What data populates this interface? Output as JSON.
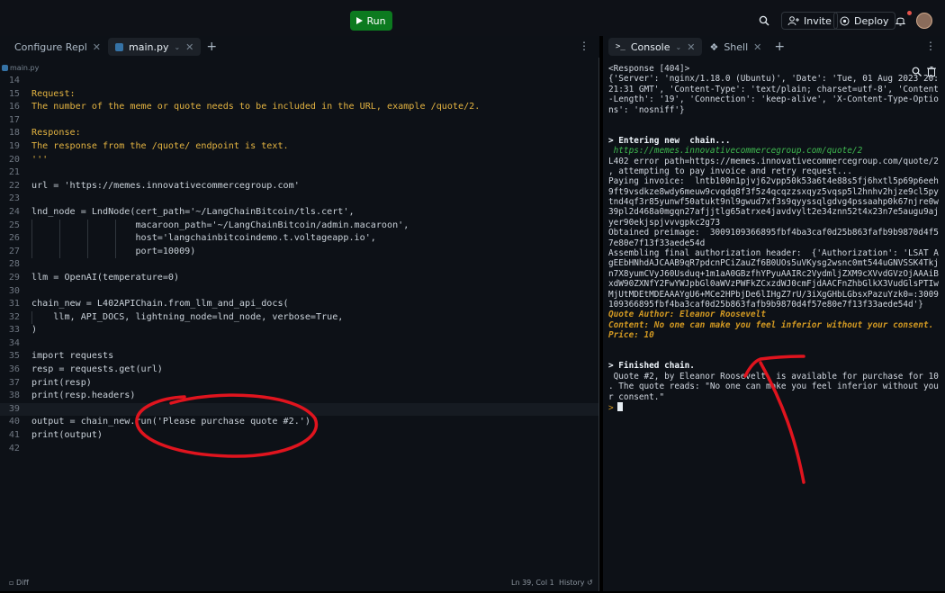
{
  "topbar": {
    "run_label": "Run",
    "invite_label": "Invite",
    "deploy_label": "Deploy"
  },
  "left_tabs": [
    {
      "label": "Configure Repl"
    },
    {
      "label": "main.py"
    }
  ],
  "breadcrumb": "main.py",
  "code_lines": [
    {
      "n": "14",
      "t": ""
    },
    {
      "n": "15",
      "t": "Request:"
    },
    {
      "n": "16",
      "t": "The number of the meme or quote needs to be included in the URL, example /quote/2."
    },
    {
      "n": "17",
      "t": ""
    },
    {
      "n": "18",
      "t": "Response:"
    },
    {
      "n": "19",
      "t": "The response from the /quote/ endpoint is text."
    },
    {
      "n": "20",
      "t": "'''"
    },
    {
      "n": "21",
      "t": ""
    },
    {
      "n": "22",
      "t": "url = 'https://memes.innovativecommercegroup.com'"
    },
    {
      "n": "23",
      "t": ""
    },
    {
      "n": "24",
      "t": "lnd_node = LndNode(cert_path='~/LangChainBitcoin/tls.cert',"
    },
    {
      "n": "25",
      "t": "                   macaroon_path='~/LangChainBitcoin/admin.macaroon',"
    },
    {
      "n": "26",
      "t": "                   host='langchainbitcoindemo.t.voltageapp.io',"
    },
    {
      "n": "27",
      "t": "                   port=10009)"
    },
    {
      "n": "28",
      "t": ""
    },
    {
      "n": "29",
      "t": "llm = OpenAI(temperature=0)"
    },
    {
      "n": "30",
      "t": ""
    },
    {
      "n": "31",
      "t": "chain_new = L402APIChain.from_llm_and_api_docs("
    },
    {
      "n": "32",
      "t": "    llm, API_DOCS, lightning_node=lnd_node, verbose=True,"
    },
    {
      "n": "33",
      "t": ")"
    },
    {
      "n": "34",
      "t": ""
    },
    {
      "n": "35",
      "t": "import requests"
    },
    {
      "n": "36",
      "t": "resp = requests.get(url)"
    },
    {
      "n": "37",
      "t": "print(resp)"
    },
    {
      "n": "38",
      "t": "print(resp.headers)"
    },
    {
      "n": "39",
      "t": ""
    },
    {
      "n": "40",
      "t": "output = chain_new.run('Please purchase quote #2.')"
    },
    {
      "n": "41",
      "t": "print(output)"
    },
    {
      "n": "42",
      "t": ""
    }
  ],
  "status": {
    "diff_label": "Diff",
    "cursor_pos": "Ln 39, Col 1",
    "history_label": "History"
  },
  "right_tabs": [
    {
      "label": "Console"
    },
    {
      "label": "Shell"
    }
  ],
  "console_lines": [
    {
      "t": "<Response [404]>",
      "s": ""
    },
    {
      "t": "{'Server': 'nginx/1.18.0 (Ubuntu)', 'Date': 'Tue, 01 Aug 2023 20:",
      "s": ""
    },
    {
      "t": "21:31 GMT', 'Content-Type': 'text/plain; charset=utf-8', 'Content",
      "s": ""
    },
    {
      "t": "-Length': '19', 'Connection': 'keep-alive', 'X-Content-Type-Optio",
      "s": ""
    },
    {
      "t": "ns': 'nosniff'}",
      "s": ""
    },
    {
      "t": "",
      "s": ""
    },
    {
      "t": "",
      "s": ""
    },
    {
      "t": "> Entering new  chain...",
      "s": "bold"
    },
    {
      "t": " https://memes.innovativecommercegroup.com/quote/2",
      "s": "url"
    },
    {
      "t": "L402 error path=https://memes.innovativecommercegroup.com/quote/2",
      "s": ""
    },
    {
      "t": ", attempting to pay invoice and retry request...",
      "s": ""
    },
    {
      "t": "Paying invoice:  lntb100n1pjvj62vpp50k53a6t4e88s5fj6hxtl5p69p6eeh",
      "s": ""
    },
    {
      "t": "9ft9vsdkze8wdy6meuw9cvqdq8f3f5z4qcqzzsxqyz5vqsp5l2hnhv2hjze9cl5py",
      "s": ""
    },
    {
      "t": "tnd4qf3r85yunwf50atukt9nl9gwud7xf3s9qyyssqlgdvg4pssaahp0k67njre0w",
      "s": ""
    },
    {
      "t": "39pl2d468a0mgqn27afjjtlg65atrxe4javdvylt2e34znn52t4x23n7e5augu9aj",
      "s": ""
    },
    {
      "t": "yer90ekjspjvvvgpkc2g73",
      "s": ""
    },
    {
      "t": "Obtained preimage:  3009109366895fbf4ba3caf0d25b863fafb9b9870d4f5",
      "s": ""
    },
    {
      "t": "7e80e7f13f33aede54d",
      "s": ""
    },
    {
      "t": "Assembling final authorization header:  {'Authorization': 'LSAT A",
      "s": ""
    },
    {
      "t": "gEEbHNhdAJCAAB9qR7pdcnPCiZauZf6B0UOs5uVKysg2wsnc0mt544uGNVSSK4Tkj",
      "s": ""
    },
    {
      "t": "n7X8yumCVyJ60Usduq+1m1aA0GBzfhYPyuAAIRc2VydmljZXM9cXVvdGVzOjAAAiB",
      "s": ""
    },
    {
      "t": "xdW90ZXNfY2FwYWJpbGl0aWVzPWFkZCxzdWJ0cmFjdAACFnZhbGlkX3VudGlsPTIw",
      "s": ""
    },
    {
      "t": "MjUtMDEtMDEAAAYgU6+MCe2HPbjDe6lIHgZ7rU/3iXgGHbLGbsxPazuYzk0=:3009",
      "s": ""
    },
    {
      "t": "109366895fbf4ba3caf0d25b863fafb9b9870d4f57e80e7f13f33aede54d'}",
      "s": ""
    },
    {
      "t": "Quote Author: Eleanor Roosevelt",
      "s": "yellow"
    },
    {
      "t": "Content: No one can make you feel inferior without your consent.",
      "s": "yellow"
    },
    {
      "t": "Price: 10",
      "s": "yellow"
    },
    {
      "t": "",
      "s": ""
    },
    {
      "t": "",
      "s": ""
    },
    {
      "t": "> Finished chain.",
      "s": "bold"
    },
    {
      "t": " Quote #2, by Eleanor Roosevelt, is available for purchase for 10",
      "s": ""
    },
    {
      "t": ". The quote reads: \"No one can make you feel inferior without you",
      "s": ""
    },
    {
      "t": "r consent.\"",
      "s": ""
    }
  ],
  "prompt": ">",
  "colors": {
    "run_green": "#0c7a1f",
    "docstring": "#e3b341",
    "url_green": "#3fb950",
    "quote_yellow": "#d29922",
    "annotation_red": "#e0141e"
  }
}
